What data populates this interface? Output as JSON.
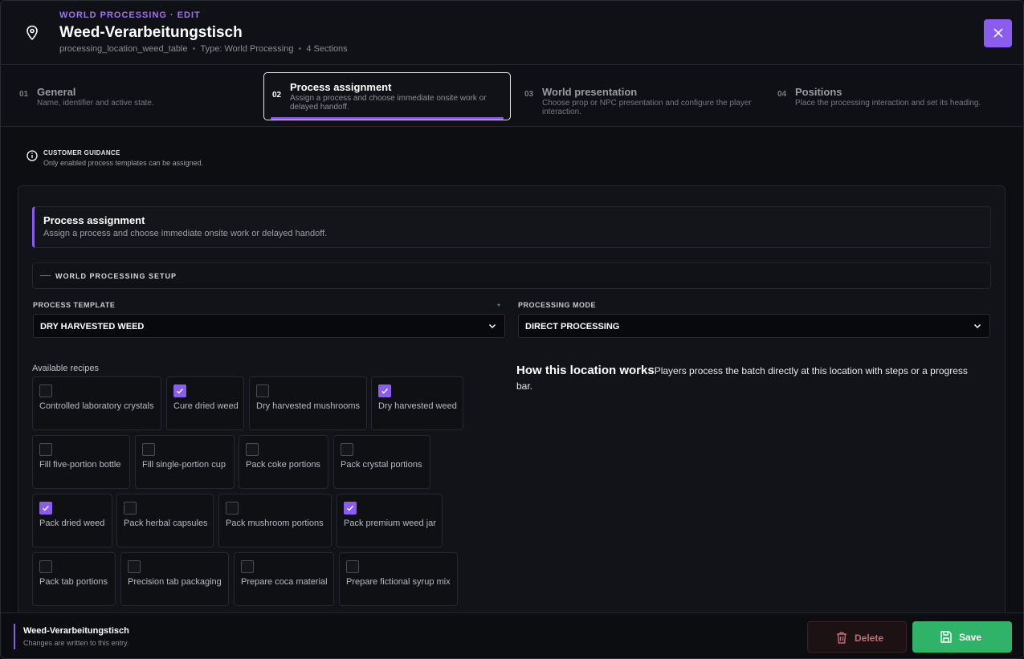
{
  "header": {
    "eyebrow": "WORLD PROCESSING · EDIT",
    "title": "Weed-Verarbeitungstisch",
    "identifier": "processing_location_weed_table",
    "type": "Type: World Processing",
    "sections": "4 Sections",
    "close_icon": "close-icon"
  },
  "steps": [
    {
      "num": "01",
      "title": "General",
      "desc": "Name, identifier and active state."
    },
    {
      "num": "02",
      "title": "Process assignment",
      "desc": "Assign a process and choose immediate onsite work or delayed handoff."
    },
    {
      "num": "03",
      "title": "World presentation",
      "desc": "Choose prop or NPC presentation and configure the player interaction."
    },
    {
      "num": "04",
      "title": "Positions",
      "desc": "Place the processing interaction and set its heading."
    }
  ],
  "guidance": {
    "title": "CUSTOMER GUIDANCE",
    "text": "Only enabled process templates can be assigned."
  },
  "section": {
    "title": "Process assignment",
    "desc": "Assign a process and choose immediate onsite work or delayed handoff.",
    "setup_label": "WORLD PROCESSING SETUP"
  },
  "fields": {
    "template_label": "PROCESS TEMPLATE",
    "template_value": "DRY HARVESTED WEED",
    "required_mark": "*",
    "mode_label": "PROCESSING MODE",
    "mode_value": "DIRECT PROCESSING"
  },
  "recipes_label": "Available recipes",
  "recipes": [
    {
      "label": "Controlled laboratory crystals",
      "checked": false
    },
    {
      "label": "Cure dried weed",
      "checked": true
    },
    {
      "label": "Dry harvested mushrooms",
      "checked": false
    },
    {
      "label": "Dry harvested weed",
      "checked": true
    },
    {
      "label": "Fill five-portion bottle",
      "checked": false
    },
    {
      "label": "Fill single-portion cup",
      "checked": false
    },
    {
      "label": "Pack coke portions",
      "checked": false
    },
    {
      "label": "Pack crystal portions",
      "checked": false
    },
    {
      "label": "Pack dried weed",
      "checked": true
    },
    {
      "label": "Pack herbal capsules",
      "checked": false
    },
    {
      "label": "Pack mushroom portions",
      "checked": false
    },
    {
      "label": "Pack premium weed jar",
      "checked": true
    },
    {
      "label": "Pack tab portions",
      "checked": false
    },
    {
      "label": "Precision tab packaging",
      "checked": false
    },
    {
      "label": "Prepare coca material",
      "checked": false
    },
    {
      "label": "Prepare fictional syrup mix",
      "checked": false
    }
  ],
  "how": {
    "title": "How this location works",
    "text": "Players process the batch directly at this location with steps or a progress bar."
  },
  "footer": {
    "title": "Weed-Verarbeitungstisch",
    "subtitle": "Changes are written to this entry.",
    "delete_label": "Delete",
    "save_label": "Save"
  },
  "colors": {
    "accent": "#8a5cf0",
    "save": "#2fb369",
    "delete_text": "#c76b72",
    "required": "#3ecf7a"
  }
}
